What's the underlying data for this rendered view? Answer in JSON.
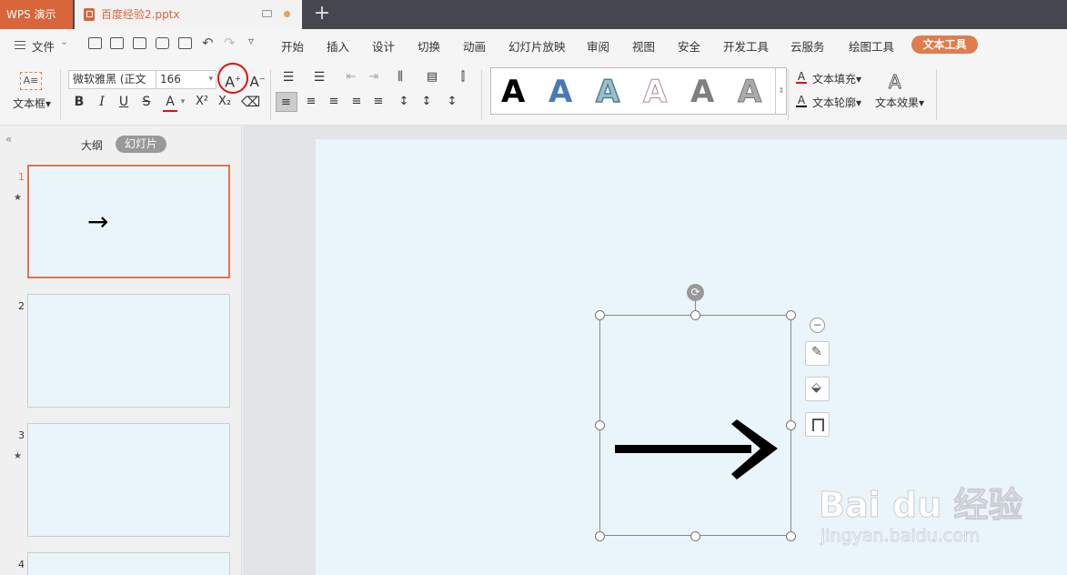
{
  "app": {
    "tab_label": "WPS 演示"
  },
  "document": {
    "tab_title": "百度经验2.pptx",
    "new_tab_label": "+"
  },
  "menu": {
    "file_label": "文件",
    "items": [
      "开始",
      "插入",
      "设计",
      "切换",
      "动画",
      "幻灯片放映",
      "审阅",
      "视图",
      "安全",
      "开发工具",
      "云服务",
      "绘图工具"
    ],
    "active_tab": "文本工具"
  },
  "ribbon": {
    "textbox_label": "文本框",
    "font_name": "微软雅黑 (正文",
    "font_size": "166",
    "increase_font_label": "A",
    "decrease_font_label": "A",
    "bold": "B",
    "italic": "I",
    "underline": "U",
    "strike": "S",
    "font_color": "A",
    "superscript": "X²",
    "subscript": "X₂",
    "styles_label": "A",
    "text_fill_label": "文本填充",
    "text_outline_label": "文本轮廓",
    "text_effect_label": "文本效果"
  },
  "sidebar": {
    "outline_tab": "大纲",
    "slides_tab": "幻灯片",
    "slides": [
      {
        "number": "1",
        "content": "→",
        "has_star": true
      },
      {
        "number": "2",
        "content": "",
        "has_star": false
      },
      {
        "number": "3",
        "content": "",
        "has_star": true
      },
      {
        "number": "4",
        "content": "",
        "has_star": false
      }
    ]
  },
  "slide": {
    "content": "→"
  },
  "watermark": {
    "brand": "Bai du 经验",
    "url": "jingyan.baidu.com"
  },
  "colors": {
    "accent": "#d9653b",
    "slide_bg": "#eaf4fb",
    "titlebar": "#45474e"
  }
}
